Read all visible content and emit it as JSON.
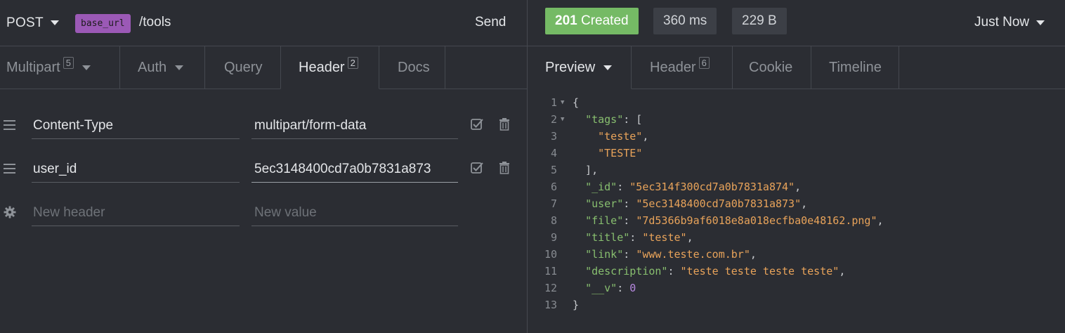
{
  "request": {
    "method": "POST",
    "url_variable": "base_url",
    "url_path": "/tools",
    "send_label": "Send"
  },
  "request_tabs": [
    {
      "label": "Multipart",
      "badge": "5",
      "has_caret": true
    },
    {
      "label": "Auth",
      "badge": "",
      "has_caret": true
    },
    {
      "label": "Query",
      "badge": "",
      "has_caret": false
    },
    {
      "label": "Header",
      "badge": "2",
      "has_caret": false,
      "active": true
    },
    {
      "label": "Docs",
      "badge": "",
      "has_caret": false
    }
  ],
  "headers": [
    {
      "name": "Content-Type",
      "value": "multipart/form-data"
    },
    {
      "name": "user_id",
      "value": "5ec3148400cd7a0b7831a873"
    }
  ],
  "new_header": {
    "name_placeholder": "New header",
    "value_placeholder": "New value"
  },
  "response": {
    "status_code": "201",
    "status_text": "Created",
    "status_color": "#75ba65",
    "time": "360 ms",
    "size": "229 B",
    "history_label": "Just Now"
  },
  "response_tabs": [
    {
      "label": "Preview",
      "badge": "",
      "has_caret": true,
      "active": true
    },
    {
      "label": "Header",
      "badge": "6",
      "has_caret": false
    },
    {
      "label": "Cookie",
      "badge": "",
      "has_caret": false
    },
    {
      "label": "Timeline",
      "badge": "",
      "has_caret": false
    }
  ],
  "code_lines": [
    {
      "n": "1",
      "fold": true,
      "parts": [
        [
          "p",
          "{"
        ]
      ]
    },
    {
      "n": "2",
      "fold": true,
      "parts": [
        [
          "p",
          "  "
        ],
        [
          "k",
          "\"tags\""
        ],
        [
          "p",
          ": ["
        ]
      ]
    },
    {
      "n": "3",
      "fold": false,
      "parts": [
        [
          "p",
          "    "
        ],
        [
          "s",
          "\"teste\""
        ],
        [
          "p",
          ","
        ]
      ]
    },
    {
      "n": "4",
      "fold": false,
      "parts": [
        [
          "p",
          "    "
        ],
        [
          "s",
          "\"TESTE\""
        ]
      ]
    },
    {
      "n": "5",
      "fold": false,
      "parts": [
        [
          "p",
          "  ],"
        ]
      ]
    },
    {
      "n": "6",
      "fold": false,
      "parts": [
        [
          "p",
          "  "
        ],
        [
          "k",
          "\"_id\""
        ],
        [
          "p",
          ": "
        ],
        [
          "s",
          "\"5ec314f300cd7a0b7831a874\""
        ],
        [
          "p",
          ","
        ]
      ]
    },
    {
      "n": "7",
      "fold": false,
      "parts": [
        [
          "p",
          "  "
        ],
        [
          "k",
          "\"user\""
        ],
        [
          "p",
          ": "
        ],
        [
          "s",
          "\"5ec3148400cd7a0b7831a873\""
        ],
        [
          "p",
          ","
        ]
      ]
    },
    {
      "n": "8",
      "fold": false,
      "parts": [
        [
          "p",
          "  "
        ],
        [
          "k",
          "\"file\""
        ],
        [
          "p",
          ": "
        ],
        [
          "s",
          "\"7d5366b9af6018e8a018ecfba0e48162.png\""
        ],
        [
          "p",
          ","
        ]
      ]
    },
    {
      "n": "9",
      "fold": false,
      "parts": [
        [
          "p",
          "  "
        ],
        [
          "k",
          "\"title\""
        ],
        [
          "p",
          ": "
        ],
        [
          "s",
          "\"teste\""
        ],
        [
          "p",
          ","
        ]
      ]
    },
    {
      "n": "10",
      "fold": false,
      "parts": [
        [
          "p",
          "  "
        ],
        [
          "k",
          "\"link\""
        ],
        [
          "p",
          ": "
        ],
        [
          "s",
          "\"www.teste.com.br\""
        ],
        [
          "p",
          ","
        ]
      ]
    },
    {
      "n": "11",
      "fold": false,
      "parts": [
        [
          "p",
          "  "
        ],
        [
          "k",
          "\"description\""
        ],
        [
          "p",
          ": "
        ],
        [
          "s",
          "\"teste teste teste teste\""
        ],
        [
          "p",
          ","
        ]
      ]
    },
    {
      "n": "12",
      "fold": false,
      "parts": [
        [
          "p",
          "  "
        ],
        [
          "k",
          "\"__v\""
        ],
        [
          "p",
          ": "
        ],
        [
          "n",
          "0"
        ]
      ]
    },
    {
      "n": "13",
      "fold": false,
      "parts": [
        [
          "p",
          "}"
        ]
      ]
    }
  ]
}
